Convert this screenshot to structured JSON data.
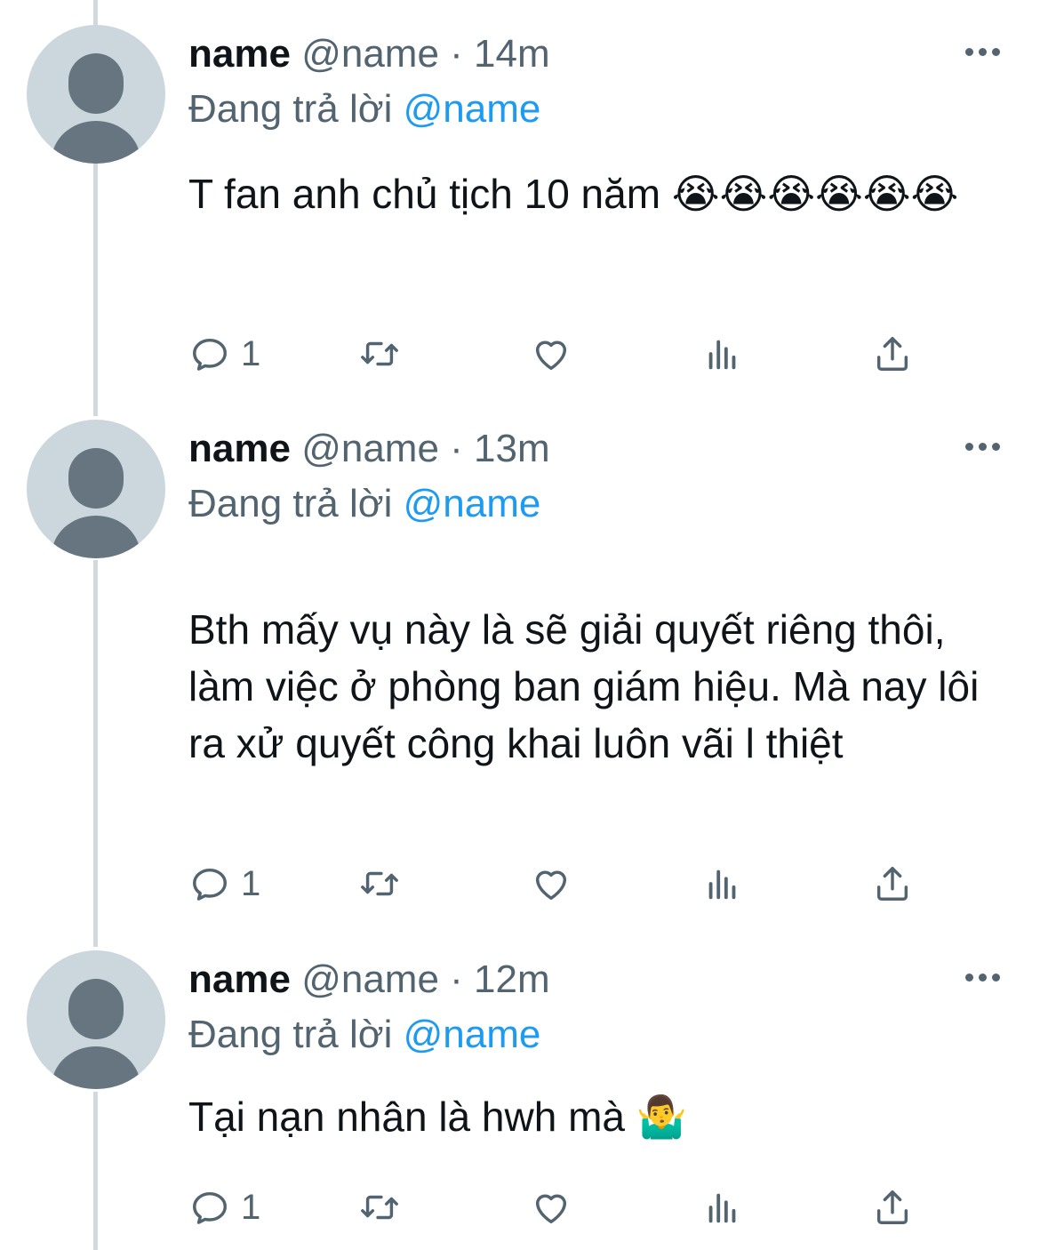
{
  "tweets": [
    {
      "name": "name",
      "handle": "@name",
      "dot": "·",
      "time": "14m",
      "reply_prefix": "Đang trả lời",
      "reply_to": "@name",
      "text": "T fan anh chủ tịch 10 năm 😭😭😭😭😭😭",
      "reply_count": "1"
    },
    {
      "name": "name",
      "handle": "@name",
      "dot": "·",
      "time": "13m",
      "reply_prefix": "Đang trả lời",
      "reply_to": "@name",
      "text": "Bth mấy vụ này là sẽ giải quyết riêng thôi, làm việc ở phòng ban giám hiệu. Mà nay lôi ra xử quyết công khai luôn vãi l thiệt",
      "reply_count": "1"
    },
    {
      "name": "name",
      "handle": "@name",
      "dot": "·",
      "time": "12m",
      "reply_prefix": "Đang trả lời",
      "reply_to": "@name",
      "text": "Tại nạn nhân là hwh mà 🤷‍♂️",
      "reply_count": "1"
    }
  ],
  "icons": {
    "reply": "reply-icon",
    "retweet": "retweet-icon",
    "like": "heart-icon",
    "views": "views-icon",
    "share": "share-icon",
    "more": "more-icon"
  },
  "colors": {
    "text": "#0f1419",
    "secondary": "#536471",
    "link": "#1d9bf0",
    "thread_line": "#cfd9de",
    "avatar_bg": "#ccd6dd",
    "avatar_fg": "#66757f"
  }
}
